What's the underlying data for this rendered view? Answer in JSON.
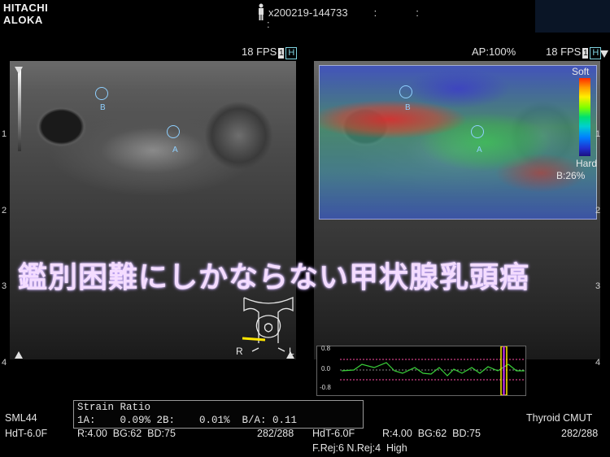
{
  "brand": {
    "line1": "HITACHI",
    "line2": "ALOKA"
  },
  "header": {
    "patient_id": "x200219-144733",
    "sep1": ":",
    "sep2": ":",
    "sep3": ":"
  },
  "left_panel": {
    "fps": "18 FPS",
    "frame": "1",
    "mode": "H",
    "roi": [
      {
        "label": "B"
      },
      {
        "label": "A"
      }
    ],
    "depth_ticks": [
      "1",
      "2",
      "3",
      "4"
    ]
  },
  "right_panel": {
    "ap": "AP:100%",
    "fps": "18 FPS",
    "frame": "1",
    "mode": "H",
    "roi": [
      {
        "label": "B"
      },
      {
        "label": "A"
      }
    ],
    "colorbar": {
      "top": "Soft",
      "bottom": "Hard",
      "b_pct": "B:26%"
    },
    "depth_ticks": [
      "1",
      "2",
      "3",
      "4"
    ]
  },
  "overlay_caption": "鑑別困難にしかならない甲状腺乳頭癌",
  "body_marker": {
    "r": "R",
    "l": "L"
  },
  "strain_ratio": {
    "title": "Strain Ratio",
    "line": "1A:    0.09% 2B:    0.01%  B/A: 0.11"
  },
  "chart": {
    "ticks": [
      "0.8",
      "0.0",
      "-0.8"
    ]
  },
  "footer": {
    "left_probe": "SML44",
    "left_hdt": "HdT-6.0F",
    "left_params": "R:4.00  BG:62  BD:75",
    "left_count": "282/288",
    "mid_hdt": "HdT-6.0F",
    "mid_params": "R:4.00  BG:62  BD:75",
    "mid_rej": "F.Rej:6 N.Rej:4  High",
    "preset": "Thyroid CMUT",
    "right_count": "282/288"
  },
  "colors": {
    "roi": "#8fd0ff",
    "caption": "#f4dcff",
    "hbox": "#7fd3e0"
  }
}
